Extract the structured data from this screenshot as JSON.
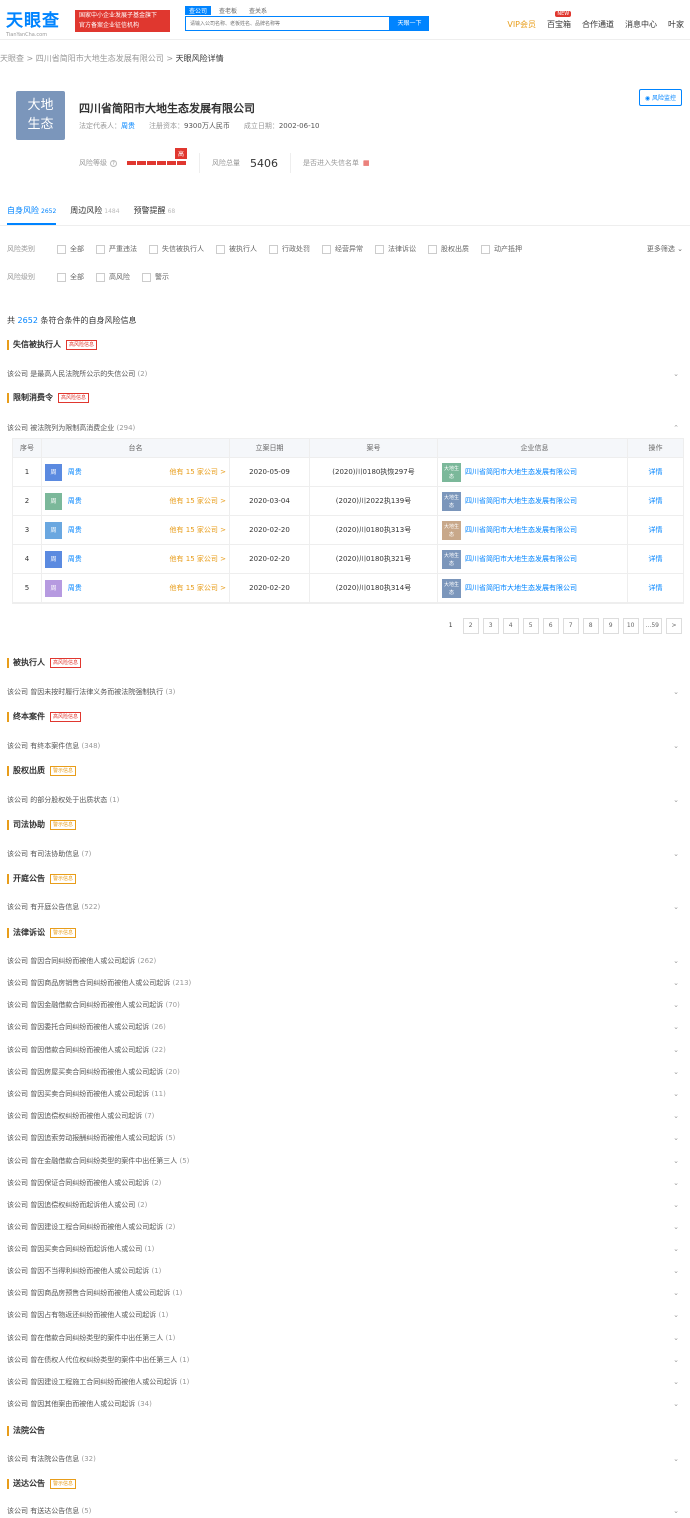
{
  "header": {
    "logo_cn": "天眼查",
    "logo_en": "TianYanCha.com",
    "promo_line1": "国家中小企业发展子基金旗下",
    "promo_line2": "官方备案企业征信机构",
    "search_tabs": [
      "查公司",
      "查老板",
      "查关系"
    ],
    "search_placeholder": "请输入公司名称、老板姓名、品牌名称等",
    "search_button": "天眼一下",
    "nav": [
      "VIP会员",
      "百宝箱",
      "合作通道",
      "消息中心",
      "叶家"
    ],
    "nav_badge": "NEW"
  },
  "breadcrumb": [
    "天眼查",
    "四川省简阳市大地生态发展有限公司",
    "天眼风险详情"
  ],
  "company": {
    "avatar_text": [
      "大地",
      "生态"
    ],
    "name": "四川省简阳市大地生态发展有限公司",
    "legal_label": "法定代表人：",
    "legal_rep": "周贵",
    "capital_label": "注册资本：",
    "capital": "9300万人民币",
    "date_label": "成立日期：",
    "date": "2002-06-10",
    "monitor_button": "风险监控",
    "risk_level_label": "风险等级",
    "risk_level": "高",
    "risk_level_fraction": 1,
    "risk_total_label": "风险总量",
    "risk_total": "5406",
    "dishonest_label": "是否进入失信名单"
  },
  "tabs": [
    {
      "label": "自身风险",
      "count": "2652"
    },
    {
      "label": "周边风险",
      "count": "1484"
    },
    {
      "label": "预警提醒",
      "count": "68"
    }
  ],
  "filters": {
    "type_label": "风险类别",
    "types": [
      "全部",
      "严重违法",
      "失信被执行人",
      "被执行人",
      "行政处罚",
      "经营异常",
      "法律诉讼",
      "股权出质",
      "动产抵押"
    ],
    "more": "更多筛选",
    "level_label": "风险级别",
    "levels": [
      "全部",
      "高风险",
      "警示"
    ]
  },
  "total": {
    "prefix": "共",
    "count": "2652",
    "suffix": "条符合条件的自身风险信息"
  },
  "sections": {
    "s1": {
      "title": "失信被执行人",
      "tag": "高风险信息",
      "rows": [
        {
          "text": "该公司 是最高人民法院所公示的失信公司",
          "count": "(2)"
        }
      ]
    },
    "s2": {
      "title": "限制消费令",
      "tag": "高风险信息",
      "rows": [
        {
          "text": "该公司 被法院列为限制高消费企业",
          "count": "(294)"
        }
      ]
    },
    "s3": {
      "title": "被执行人",
      "tag": "高风险信息",
      "rows": [
        {
          "text": "该公司 曾因未按时履行法律义务而被法院强制执行",
          "count": "(3)"
        }
      ]
    },
    "s4": {
      "title": "终本案件",
      "tag": "高风险信息",
      "rows": [
        {
          "text": "该公司 有终本案件信息",
          "count": "(348)"
        }
      ]
    },
    "s5": {
      "title": "股权出质",
      "tag": "警示信息",
      "rows": [
        {
          "text": "该公司 的部分股权处于出质状态",
          "count": "(1)"
        }
      ]
    },
    "s6": {
      "title": "司法协助",
      "tag": "警示信息",
      "rows": [
        {
          "text": "该公司 有司法协助信息",
          "count": "(7)"
        }
      ]
    },
    "s7": {
      "title": "开庭公告",
      "tag": "警示信息",
      "rows": [
        {
          "text": "该公司 有开庭公告信息",
          "count": "(522)"
        }
      ]
    },
    "s8": {
      "title": "法律诉讼",
      "tag": "警示信息",
      "rows": [
        {
          "text": "该公司 曾因合同纠纷而被他人或公司起诉",
          "count": "(262)"
        },
        {
          "text": "该公司 曾因商品房销售合同纠纷而被他人或公司起诉",
          "count": "(213)"
        },
        {
          "text": "该公司 曾因金融借款合同纠纷而被他人或公司起诉",
          "count": "(70)"
        },
        {
          "text": "该公司 曾因委托合同纠纷而被他人或公司起诉",
          "count": "(26)"
        },
        {
          "text": "该公司 曾因借款合同纠纷而被他人或公司起诉",
          "count": "(22)"
        },
        {
          "text": "该公司 曾因房屋买卖合同纠纷而被他人或公司起诉",
          "count": "(20)"
        },
        {
          "text": "该公司 曾因买卖合同纠纷而被他人或公司起诉",
          "count": "(11)"
        },
        {
          "text": "该公司 曾因追偿权纠纷而被他人或公司起诉",
          "count": "(7)"
        },
        {
          "text": "该公司 曾因追索劳动报酬纠纷而被他人或公司起诉",
          "count": "(5)"
        },
        {
          "text": "该公司 曾在金融借款合同纠纷类型的案件中出任第三人",
          "count": "(5)"
        },
        {
          "text": "该公司 曾因保证合同纠纷而被他人或公司起诉",
          "count": "(2)"
        },
        {
          "text": "该公司 曾因追偿权纠纷而起诉他人或公司",
          "count": "(2)"
        },
        {
          "text": "该公司 曾因建设工程合同纠纷而被他人或公司起诉",
          "count": "(2)"
        },
        {
          "text": "该公司 曾因买卖合同纠纷而起诉他人或公司",
          "count": "(1)"
        },
        {
          "text": "该公司 曾因不当得利纠纷而被他人或公司起诉",
          "count": "(1)"
        },
        {
          "text": "该公司 曾因商品房预售合同纠纷而被他人或公司起诉",
          "count": "(1)"
        },
        {
          "text": "该公司 曾因占有物返还纠纷而被他人或公司起诉",
          "count": "(1)"
        },
        {
          "text": "该公司 曾在借款合同纠纷类型的案件中出任第三人",
          "count": "(1)"
        },
        {
          "text": "该公司 曾在债权人代位权纠纷类型的案件中出任第三人",
          "count": "(1)"
        },
        {
          "text": "该公司 曾因建设工程施工合同纠纷而被他人或公司起诉",
          "count": "(1)"
        },
        {
          "text": "该公司 曾因其他案由而被他人或公司起诉",
          "count": "(34)"
        }
      ]
    },
    "s9": {
      "title": "法院公告",
      "tag": "",
      "rows": [
        {
          "text": "该公司 有法院公告信息",
          "count": "(32)"
        }
      ]
    },
    "s10": {
      "title": "送达公告",
      "tag": "警示信息",
      "rows": [
        {
          "text": "该公司 有送达公告信息",
          "count": "(5)"
        }
      ]
    }
  },
  "table": {
    "headers": [
      "序号",
      "台名",
      "立案日期",
      "案号",
      "企业信息",
      "操作"
    ],
    "rows": [
      {
        "no": "1",
        "avatar": "周",
        "avatar_color": "#5b8ae0",
        "person": "周贵",
        "other": "他有 15 家公司 >",
        "date": "2020-05-09",
        "case": "(2020)川0180执恢297号",
        "logo_text": "大地生态",
        "logo_color": "#7bb89a",
        "company": "四川省简阳市大地生态发展有限公司",
        "op": "详情"
      },
      {
        "no": "2",
        "avatar": "周",
        "avatar_color": "#7bb89a",
        "person": "周贵",
        "other": "他有 15 家公司 >",
        "date": "2020-03-04",
        "case": "(2020)川2022执139号",
        "logo_text": "大地生态",
        "logo_color": "#7b96bb",
        "company": "四川省简阳市大地生态发展有限公司",
        "op": "详情"
      },
      {
        "no": "3",
        "avatar": "周",
        "avatar_color": "#6aa7e0",
        "person": "周贵",
        "other": "他有 15 家公司 >",
        "date": "2020-02-20",
        "case": "(2020)川0180执313号",
        "logo_text": "大地生态",
        "logo_color": "#c8a88a",
        "company": "四川省简阳市大地生态发展有限公司",
        "op": "详情"
      },
      {
        "no": "4",
        "avatar": "周",
        "avatar_color": "#5b8ae0",
        "person": "周贵",
        "other": "他有 15 家公司 >",
        "date": "2020-02-20",
        "case": "(2020)川0180执321号",
        "logo_text": "大地生态",
        "logo_color": "#7b96bb",
        "company": "四川省简阳市大地生态发展有限公司",
        "op": "详情"
      },
      {
        "no": "5",
        "avatar": "周",
        "avatar_color": "#b69ae0",
        "person": "周贵",
        "other": "他有 15 家公司 >",
        "date": "2020-02-20",
        "case": "(2020)川0180执314号",
        "logo_text": "大地生态",
        "logo_color": "#7b96bb",
        "company": "四川省简阳市大地生态发展有限公司",
        "op": "详情"
      }
    ]
  },
  "pager": [
    "1",
    "2",
    "3",
    "4",
    "5",
    "6",
    "7",
    "8",
    "9",
    "10",
    "...59",
    ">"
  ]
}
